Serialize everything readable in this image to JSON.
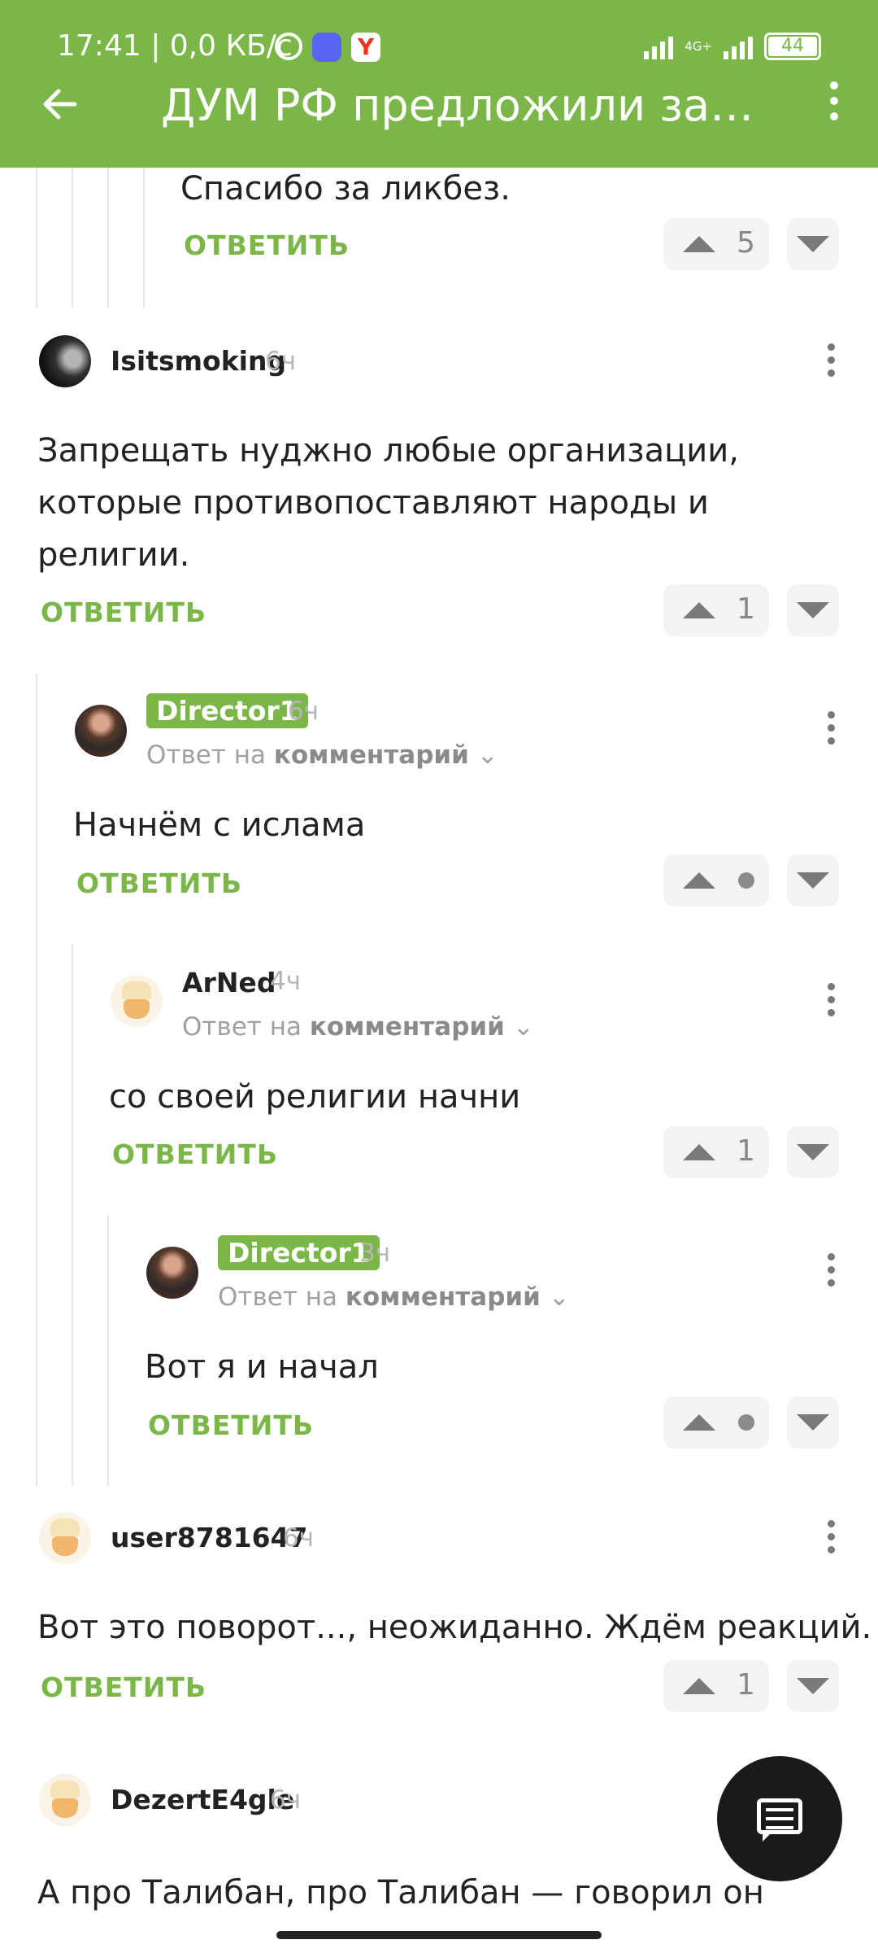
{
  "status_bar": {
    "time": "17:41 | 0,0 КБ/с",
    "network": "4G+",
    "battery": "44"
  },
  "header": {
    "title": "ДУМ РФ предложили запр..."
  },
  "reply_label": "ОТВЕТИТЬ",
  "reply_to_prefix": "Ответ на",
  "reply_to_target": "комментарий",
  "comments": [
    {
      "text": "Спасибо за ликбез.",
      "votes": "5"
    },
    {
      "user": "Isitsmoking",
      "time": "6ч",
      "text1": "Запрещать нуджно любые организации,",
      "text2": "которые противопоставляют народы и",
      "text3": "религии.",
      "votes": "1"
    },
    {
      "user": "Director1",
      "time": "6ч",
      "text": "Начнём с ислама",
      "votes": ""
    },
    {
      "user": "ArNed",
      "time": "4ч",
      "text": "со своей религии начни",
      "votes": "1"
    },
    {
      "user": "Director1",
      "time": "3ч",
      "text": "Вот я и начал",
      "votes": ""
    },
    {
      "user": "user8781647",
      "time": "6ч",
      "text": "Вот это поворот..., неожиданно. Ждём реакций.",
      "votes": "1"
    },
    {
      "user": "DezertE4gle",
      "time": "6ч",
      "text": "А про Талибан, про Талибан — говорил он"
    }
  ],
  "colors": {
    "accent": "#7ab648",
    "text": "#222222",
    "muted": "#b5b5b5"
  }
}
